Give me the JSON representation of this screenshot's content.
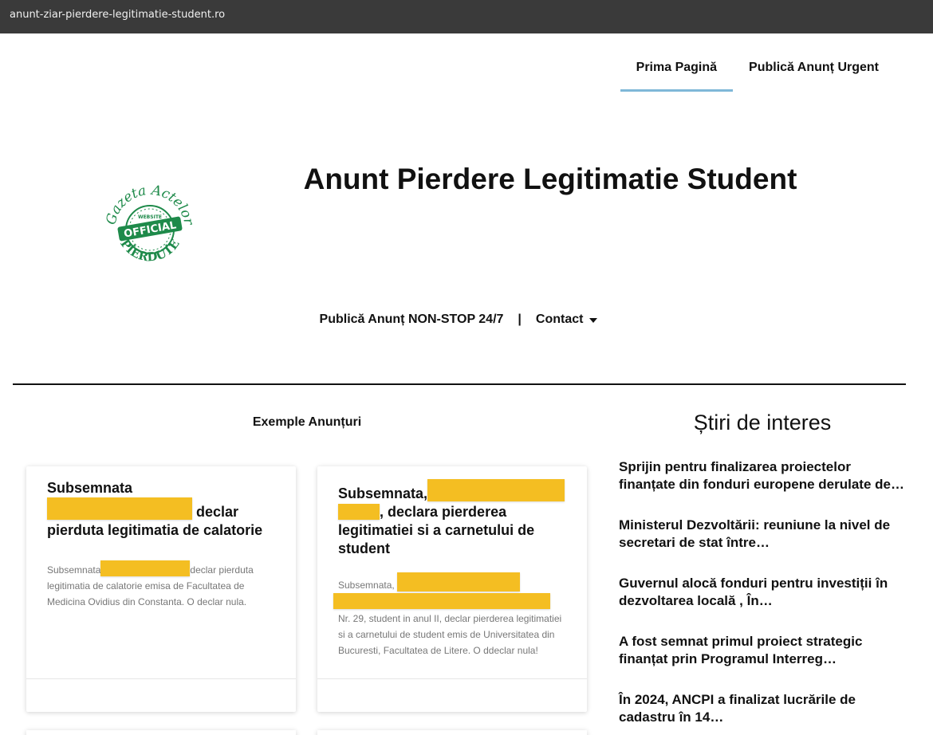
{
  "browser": {
    "url": "anunt-ziar-pierdere-legitimatie-student.ro"
  },
  "top_nav": {
    "items": [
      {
        "label": "Prima Pagină",
        "active": true
      },
      {
        "label": "Publică Anunț Urgent",
        "active": false
      }
    ]
  },
  "logo": {
    "text_top": "Gazeta Actelor",
    "text_badge_small": "WEBSITE",
    "text_badge": "OFFICIAL",
    "text_bottom": "PIERDUTE",
    "color": "#1e8a4a"
  },
  "header": {
    "title": "Anunt Pierdere Legitimatie Student"
  },
  "sub_nav": {
    "publish_label": "Publică Anunț NON-STOP 24/7",
    "separator": "|",
    "contact_label": "Contact"
  },
  "examples": {
    "heading": "Exemple Anunțuri",
    "cards": [
      {
        "title_prefix": "Subsemnata",
        "title_rest": "declar pierduta legitimatia de calatorie",
        "body_prefix": "Subsemnata",
        "body_rest": "declar pierduta legitimatia de calatorie emisa de Facultatea de Medicina Ovidius din Constanta. O declar nula."
      },
      {
        "title_prefix": "Subsemnata,",
        "title_rest": ", declara pierderea legitimatiei si a carnetului de student",
        "body_prefix": "Subsemnata,",
        "body_rest": "Nr. 29, student in anul II, declar pierderea legitimatiei si a carnetului de student emis de Universitatea din Bucuresti, Facultatea de Litere. O ddeclar nula!"
      }
    ]
  },
  "news": {
    "heading": "Știri de interes",
    "items": [
      "Sprijin pentru finalizarea proiectelor finanțate din fonduri europene derulate de…",
      "Ministerul Dezvoltării: reuniune la nivel de secretari de stat între…",
      "Guvernul alocă fonduri pentru investiții în dezvoltarea locală , În…",
      "A fost semnat primul proiect strategic finanțat prin Programul Interreg…",
      "În 2024, ANCPI a finalizat lucrările de cadastru în 14…"
    ]
  },
  "colors": {
    "redaction": "#f4be22",
    "active_tab": "#7fb8d8",
    "urlbar": "#3a3a3a"
  }
}
